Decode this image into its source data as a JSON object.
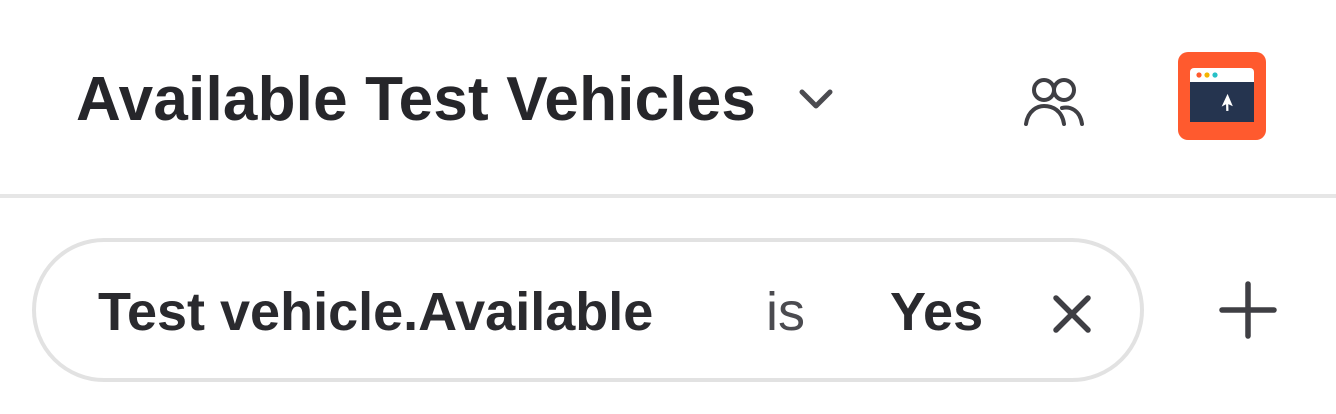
{
  "header": {
    "title": "Available Test Vehicles",
    "title_dropdown_icon": "chevron-down-icon",
    "people_icon": "people-icon",
    "app_icon": "browser-window-cursor-icon",
    "colors": {
      "title": "#26262a",
      "app_icon_bg": "#ff5a2e",
      "app_icon_panel": "#25344f"
    }
  },
  "filter": {
    "field": "Test vehicle.Available",
    "operator": "is",
    "value": "Yes",
    "remove_icon": "close-icon"
  },
  "add_filter_icon": "plus-icon"
}
